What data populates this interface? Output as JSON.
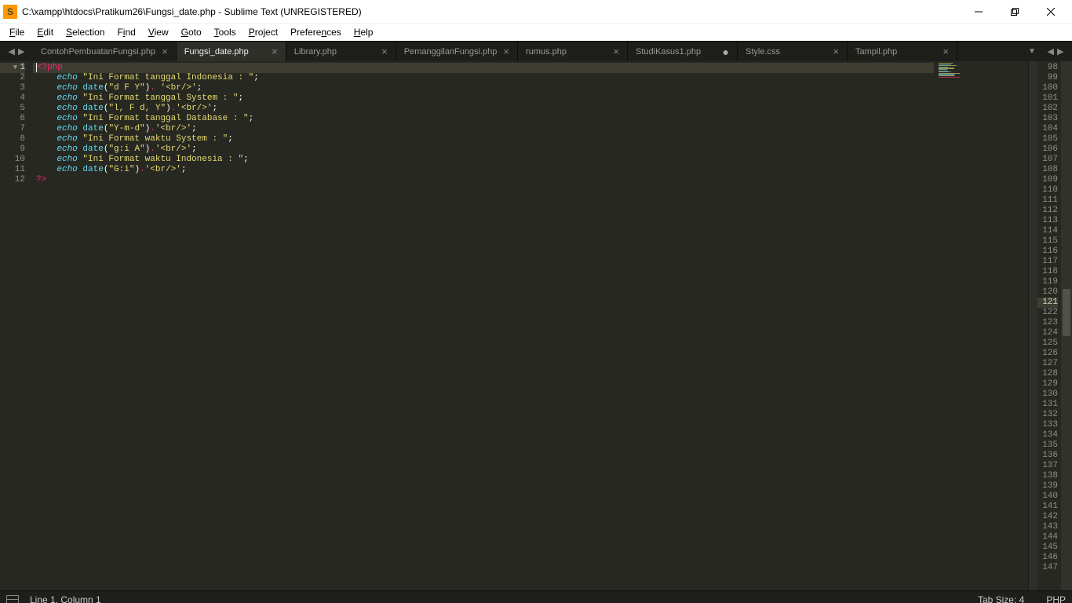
{
  "window": {
    "title": "C:\\xampp\\htdocs\\Pratikum26\\Fungsi_date.php - Sublime Text (UNREGISTERED)",
    "logo_letter": "S"
  },
  "menu": {
    "items": [
      "File",
      "Edit",
      "Selection",
      "Find",
      "View",
      "Goto",
      "Tools",
      "Project",
      "Preferences",
      "Help"
    ],
    "accel": [
      "F",
      "E",
      "S",
      "i",
      "V",
      "G",
      "T",
      "P",
      "n",
      "H"
    ]
  },
  "tabs": [
    {
      "label": "ContohPembuatanFungsi.php",
      "close": "×",
      "active": false,
      "dirty": false
    },
    {
      "label": "Fungsi_date.php",
      "close": "×",
      "active": true,
      "dirty": false
    },
    {
      "label": "Library.php",
      "close": "×",
      "active": false,
      "dirty": false
    },
    {
      "label": "PemanggilanFungsi.php",
      "close": "×",
      "active": false,
      "dirty": false
    },
    {
      "label": "rumus.php",
      "close": "×",
      "active": false,
      "dirty": false
    },
    {
      "label": "StudiKasus1.php",
      "close": "",
      "active": false,
      "dirty": true
    },
    {
      "label": "Style.css",
      "close": "×",
      "active": false,
      "dirty": false
    },
    {
      "label": "Tampil.php",
      "close": "×",
      "active": false,
      "dirty": false
    }
  ],
  "left_line_numbers": [
    1,
    2,
    3,
    4,
    5,
    6,
    7,
    8,
    9,
    10,
    11,
    12
  ],
  "active_line": 1,
  "code_lines": [
    {
      "raw": "<?php",
      "tokens": [
        {
          "c": "k-tag",
          "t": "<?php"
        }
      ]
    },
    {
      "raw": "    echo \"Ini Format tanggal Indonesia : \";",
      "tokens": [
        {
          "c": "",
          "t": "    "
        },
        {
          "c": "k-echo",
          "t": "echo"
        },
        {
          "c": "",
          "t": " "
        },
        {
          "c": "k-str",
          "t": "\"Ini Format tanggal Indonesia : \""
        },
        {
          "c": "k-punc",
          "t": ";"
        }
      ]
    },
    {
      "raw": "    echo date(\"d F Y\"). '<br/>';",
      "tokens": [
        {
          "c": "",
          "t": "    "
        },
        {
          "c": "k-echo",
          "t": "echo"
        },
        {
          "c": "",
          "t": " "
        },
        {
          "c": "k-func",
          "t": "date"
        },
        {
          "c": "k-punc",
          "t": "("
        },
        {
          "c": "k-str",
          "t": "\"d F Y\""
        },
        {
          "c": "k-punc",
          "t": ")"
        },
        {
          "c": "k-op",
          "t": "."
        },
        {
          "c": "",
          "t": " "
        },
        {
          "c": "k-str",
          "t": "'<br/>'"
        },
        {
          "c": "k-punc",
          "t": ";"
        }
      ]
    },
    {
      "raw": "    echo \"Ini Format tanggal System : \";",
      "tokens": [
        {
          "c": "",
          "t": "    "
        },
        {
          "c": "k-echo",
          "t": "echo"
        },
        {
          "c": "",
          "t": " "
        },
        {
          "c": "k-str",
          "t": "\"Ini Format tanggal System : \""
        },
        {
          "c": "k-punc",
          "t": ";"
        }
      ]
    },
    {
      "raw": "    echo date(\"l, F d, Y\").'<br/>';",
      "tokens": [
        {
          "c": "",
          "t": "    "
        },
        {
          "c": "k-echo",
          "t": "echo"
        },
        {
          "c": "",
          "t": " "
        },
        {
          "c": "k-func",
          "t": "date"
        },
        {
          "c": "k-punc",
          "t": "("
        },
        {
          "c": "k-str",
          "t": "\"l, F d, Y\""
        },
        {
          "c": "k-punc",
          "t": ")"
        },
        {
          "c": "k-op",
          "t": "."
        },
        {
          "c": "k-str",
          "t": "'<br/>'"
        },
        {
          "c": "k-punc",
          "t": ";"
        }
      ]
    },
    {
      "raw": "    echo \"Ini Format tanggal Database : \";",
      "tokens": [
        {
          "c": "",
          "t": "    "
        },
        {
          "c": "k-echo",
          "t": "echo"
        },
        {
          "c": "",
          "t": " "
        },
        {
          "c": "k-str",
          "t": "\"Ini Format tanggal Database : \""
        },
        {
          "c": "k-punc",
          "t": ";"
        }
      ]
    },
    {
      "raw": "    echo date(\"Y-m-d\").'<br/>';",
      "tokens": [
        {
          "c": "",
          "t": "    "
        },
        {
          "c": "k-echo",
          "t": "echo"
        },
        {
          "c": "",
          "t": " "
        },
        {
          "c": "k-func",
          "t": "date"
        },
        {
          "c": "k-punc",
          "t": "("
        },
        {
          "c": "k-str",
          "t": "\"Y-m-d\""
        },
        {
          "c": "k-punc",
          "t": ")"
        },
        {
          "c": "k-op",
          "t": "."
        },
        {
          "c": "k-str",
          "t": "'<br/>'"
        },
        {
          "c": "k-punc",
          "t": ";"
        }
      ]
    },
    {
      "raw": "    echo \"Ini Format waktu System : \";",
      "tokens": [
        {
          "c": "",
          "t": "    "
        },
        {
          "c": "k-echo",
          "t": "echo"
        },
        {
          "c": "",
          "t": " "
        },
        {
          "c": "k-str",
          "t": "\"Ini Format waktu System : \""
        },
        {
          "c": "k-punc",
          "t": ";"
        }
      ]
    },
    {
      "raw": "    echo date(\"g:i A\").'<br/>';",
      "tokens": [
        {
          "c": "",
          "t": "    "
        },
        {
          "c": "k-echo",
          "t": "echo"
        },
        {
          "c": "",
          "t": " "
        },
        {
          "c": "k-func",
          "t": "date"
        },
        {
          "c": "k-punc",
          "t": "("
        },
        {
          "c": "k-str",
          "t": "\"g:i A\""
        },
        {
          "c": "k-punc",
          "t": ")"
        },
        {
          "c": "k-op",
          "t": "."
        },
        {
          "c": "k-str",
          "t": "'<br/>'"
        },
        {
          "c": "k-punc",
          "t": ";"
        }
      ]
    },
    {
      "raw": "    echo \"Ini Format waktu Indonesia : \";",
      "tokens": [
        {
          "c": "",
          "t": "    "
        },
        {
          "c": "k-echo",
          "t": "echo"
        },
        {
          "c": "",
          "t": " "
        },
        {
          "c": "k-str",
          "t": "\"Ini Format waktu Indonesia : \""
        },
        {
          "c": "k-punc",
          "t": ";"
        }
      ]
    },
    {
      "raw": "    echo date(\"G:i\").'<br/>';",
      "tokens": [
        {
          "c": "",
          "t": "    "
        },
        {
          "c": "k-echo",
          "t": "echo"
        },
        {
          "c": "",
          "t": " "
        },
        {
          "c": "k-func",
          "t": "date"
        },
        {
          "c": "k-punc",
          "t": "("
        },
        {
          "c": "k-str",
          "t": "\"G:i\""
        },
        {
          "c": "k-punc",
          "t": ")"
        },
        {
          "c": "k-op",
          "t": "."
        },
        {
          "c": "k-str",
          "t": "'<br/>'"
        },
        {
          "c": "k-punc",
          "t": ";"
        }
      ]
    },
    {
      "raw": "?>",
      "tokens": [
        {
          "c": "k-tag",
          "t": "?>"
        }
      ]
    }
  ],
  "right_line_numbers_start": 98,
  "right_line_numbers_end": 147,
  "right_active_line": 121,
  "status": {
    "position": "Line 1, Column 1",
    "tab_size": "Tab Size: 4",
    "syntax": "PHP"
  },
  "mm_colors": [
    "#e6db74",
    "#66d9ef",
    "#e6db74",
    "#66d9ef",
    "#e6db74",
    "#66d9ef",
    "#e6db74",
    "#66d9ef",
    "#e6db74",
    "#66d9ef",
    "#e6db74",
    "#f92672"
  ]
}
